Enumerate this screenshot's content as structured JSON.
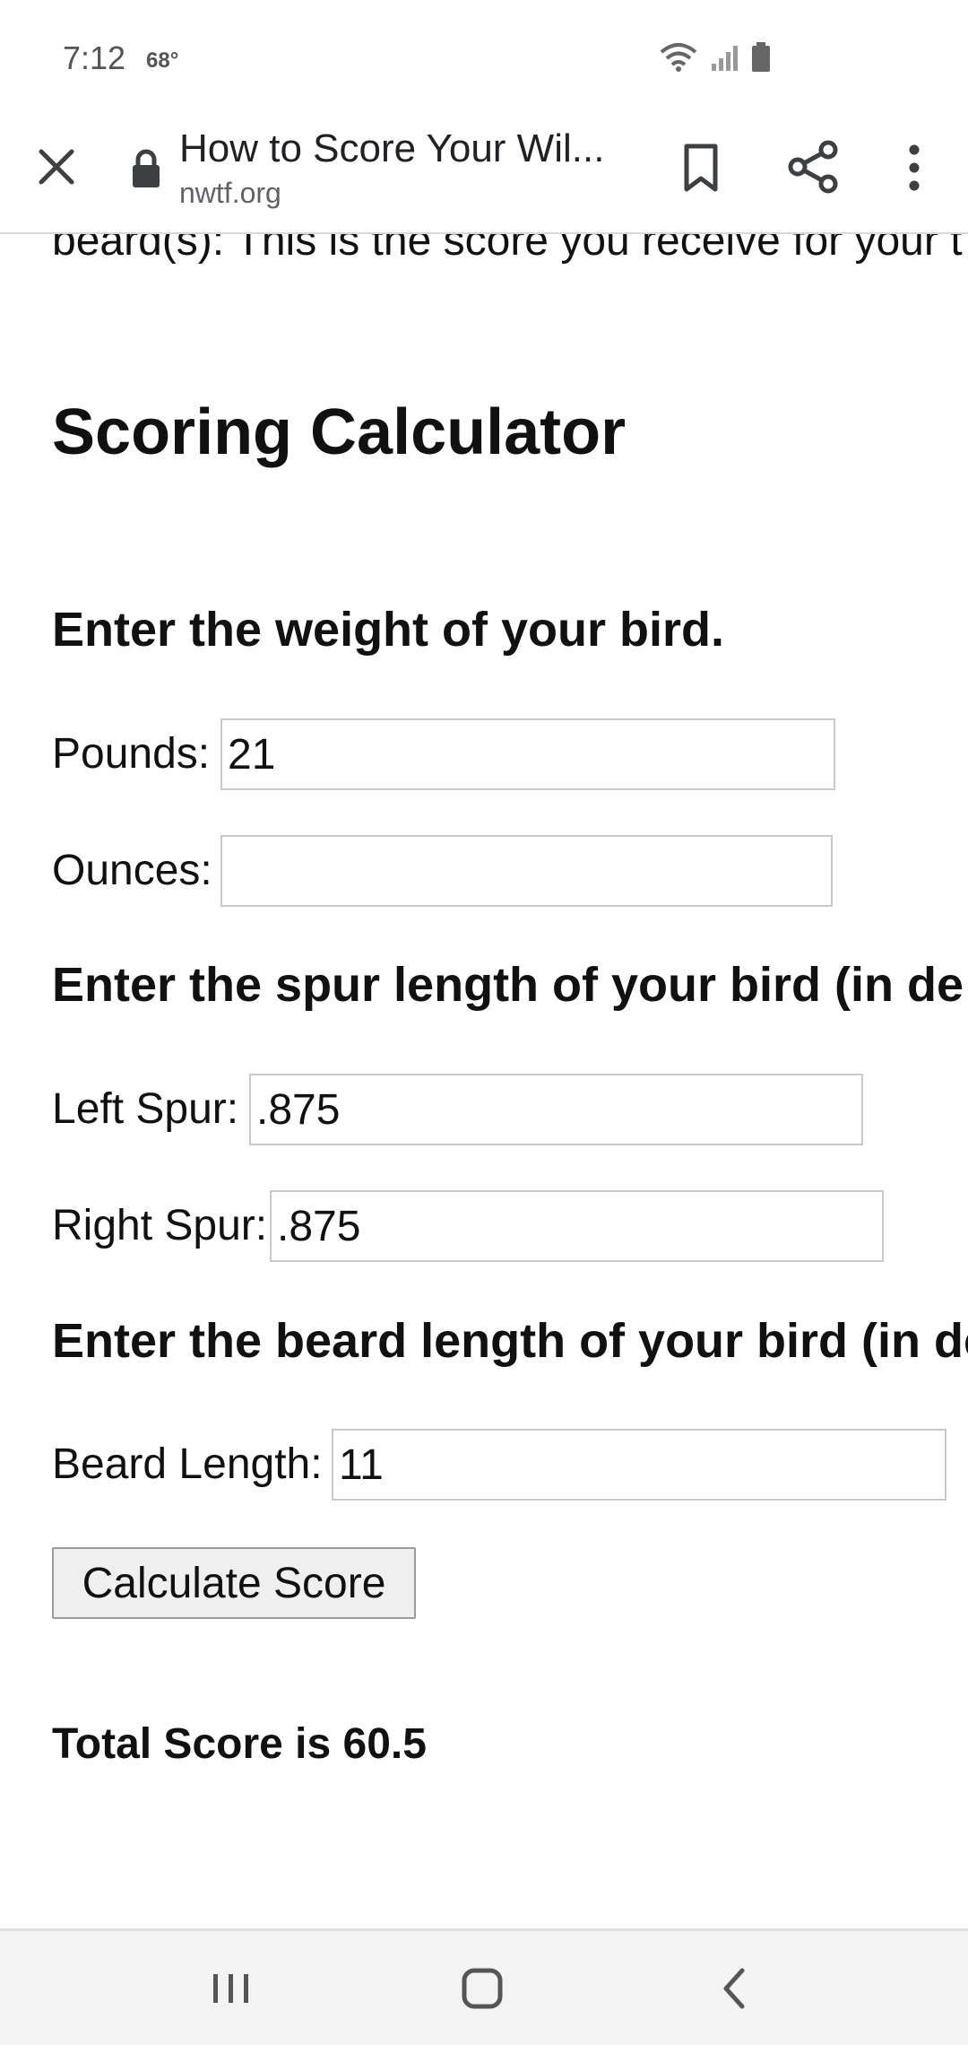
{
  "status_bar": {
    "time": "7:12",
    "temperature": "68°",
    "icons": [
      "wifi-icon",
      "signal-icon",
      "battery-icon"
    ]
  },
  "browser": {
    "page_title": "How to Score Your Wil...",
    "domain": "nwtf.org",
    "icons": [
      "close-icon",
      "lock-icon",
      "bookmark-icon",
      "share-icon",
      "more-vert-icon"
    ]
  },
  "page": {
    "cut_text": "beard(s): This is the score you receive for your t",
    "calculator_title": "Scoring Calculator",
    "weight_heading": "Enter the weight of your bird.",
    "pounds_label": "Pounds:",
    "pounds_value": "21",
    "ounces_label": "Ounces:",
    "ounces_value": "",
    "spur_heading": "Enter the spur length of your bird (in de",
    "left_spur_label": "Left Spur:",
    "left_spur_value": ".875",
    "right_spur_label": "Right Spur:",
    "right_spur_value": ".875",
    "beard_heading": "Enter the beard length of your bird (in de",
    "beard_label": "Beard Length:",
    "beard_value": "11",
    "calculate_button": "Calculate Score",
    "total_score": "Total Score is 60.5"
  },
  "navbar": {
    "icons": [
      "recent-apps-icon",
      "home-icon",
      "back-icon"
    ]
  },
  "colors": {
    "text": "#111111",
    "field_border": "#c9c9c9",
    "button_bg": "#efefef",
    "navbar_bg": "#f3f3f3"
  }
}
